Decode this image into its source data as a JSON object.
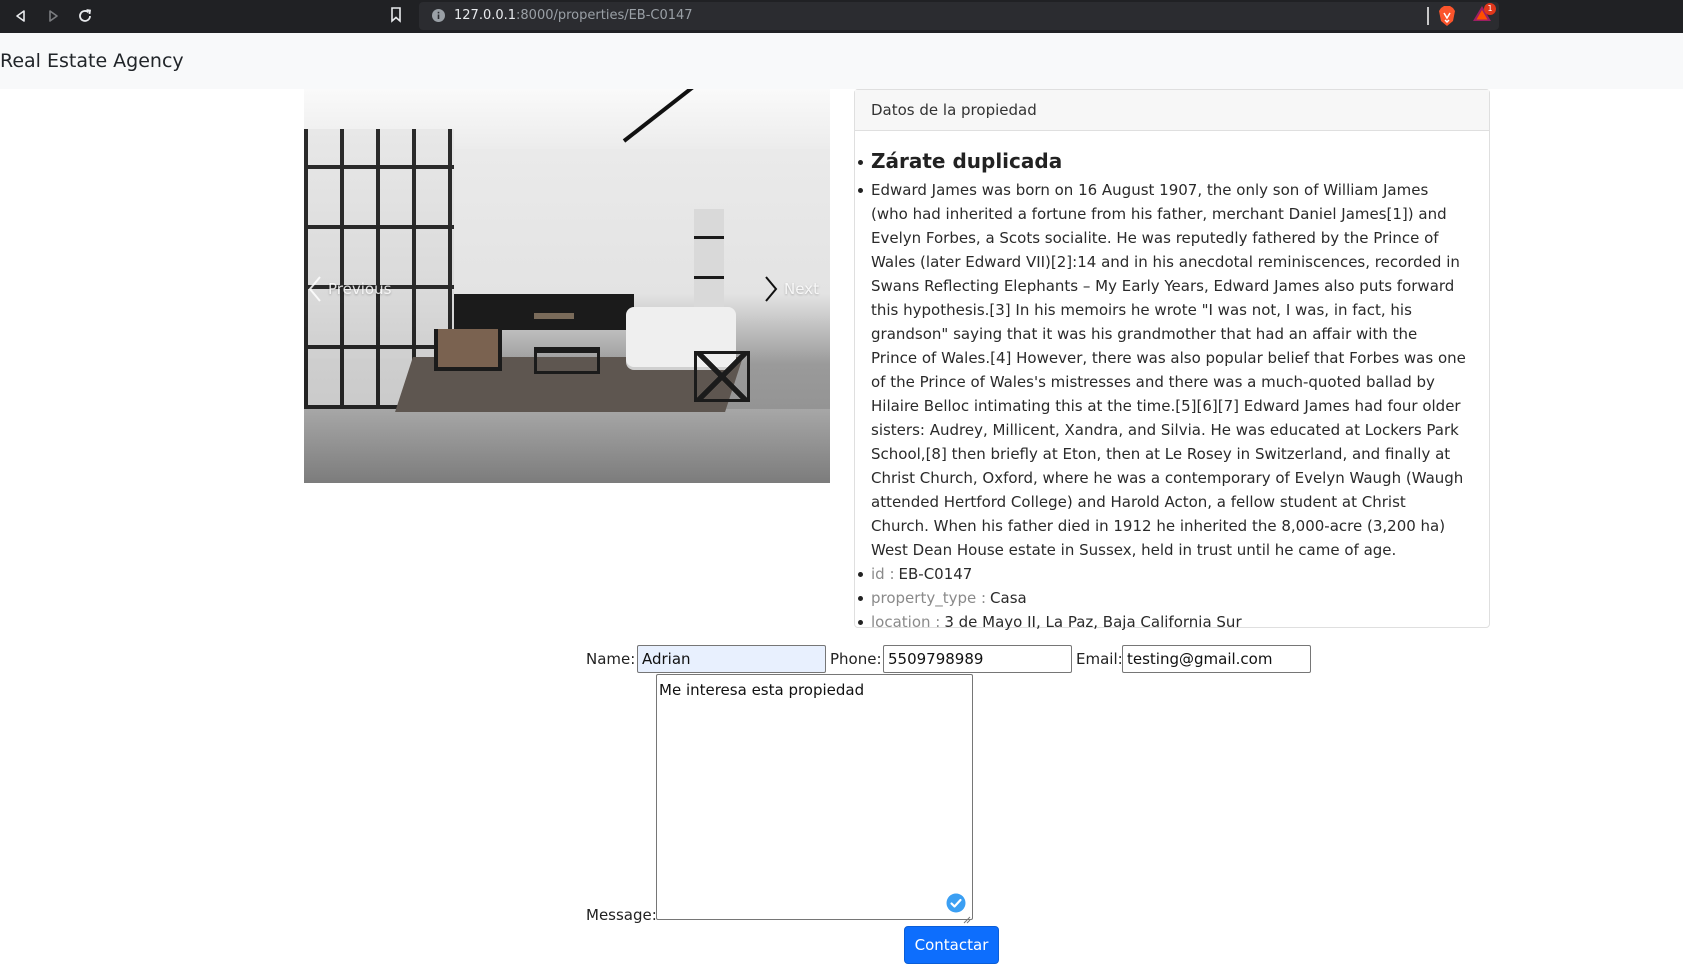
{
  "browser": {
    "url_host": "127.0.0.1",
    "url_path": ":8000/properties/EB-C0147",
    "rewards_badge": "1"
  },
  "navbar": {
    "brand": "Real Estate Agency"
  },
  "carousel": {
    "prev_label": "Previous",
    "next_label": "Next"
  },
  "property": {
    "header": "Datos de la propiedad",
    "title": "Zárate duplicada",
    "description": "Edward James was born on 16 August 1907, the only son of William James (who had inherited a fortune from his father, merchant Daniel James[1]) and Evelyn Forbes, a Scots socialite. He was reputedly fathered by the Prince of Wales (later Edward VII)[2]:14 and in his anecdotal reminiscences, recorded in Swans Reflecting Elephants – My Early Years, Edward James also puts forward this hypothesis.[3] In his memoirs he wrote \"I was not, I was, in fact, his grandson\" saying that it was his grandmother that had an affair with the Prince of Wales.[4] However, there was also popular belief that Forbes was one of the Prince of Wales's mistresses and there was a much-quoted ballad by Hilaire Belloc intimating this at the time.[5][6][7] Edward James had four older sisters: Audrey, Millicent, Xandra, and Silvia. He was educated at Lockers Park School,[8] then briefly at Eton, then at Le Rosey in Switzerland, and finally at Christ Church, Oxford, where he was a contemporary of Evelyn Waugh (Waugh attended Hertford College) and Harold Acton, a fellow student at Christ Church. When his father died in 1912 he inherited the 8,000-acre (3,200 ha) West Dean House estate in Sussex, held in trust until he came of age.",
    "fields": [
      {
        "key": "id :",
        "value": "EB-C0147"
      },
      {
        "key": "property_type :",
        "value": "Casa"
      },
      {
        "key": "location :",
        "value": "3 de Mayo II, La Paz, Baja California Sur"
      }
    ]
  },
  "form": {
    "name_label": "Name:",
    "name_value": "Adrian",
    "phone_label": "Phone:",
    "phone_value": "5509798989",
    "email_label": "Email:",
    "email_value": "testing@gmail.com",
    "message_label": "Message:",
    "message_value": "Me interesa esta propiedad",
    "submit_label": "Contactar"
  },
  "colors": {
    "primary_button": "#0d6efd",
    "navbar_bg": "#f8f9fa",
    "browser_chrome": "#202124"
  }
}
